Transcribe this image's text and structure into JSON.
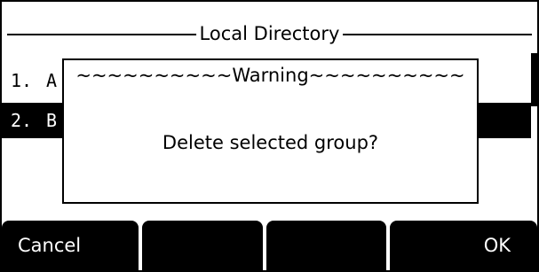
{
  "header": {
    "title": "Local Directory"
  },
  "list": {
    "items": [
      {
        "number": "1.",
        "label": "A"
      },
      {
        "number": "2.",
        "label": "B"
      }
    ]
  },
  "dialog": {
    "title": "~~~~~~~~~~Warning~~~~~~~~~~",
    "message": "Delete selected group?"
  },
  "softkeys": [
    {
      "label": "Cancel"
    },
    {
      "label": ""
    },
    {
      "label": ""
    },
    {
      "label": "OK"
    }
  ],
  "colors": {
    "foreground": "#000000",
    "background": "#ffffff",
    "selected_row_bg": "#000000",
    "softkey_bg": "#000000"
  }
}
